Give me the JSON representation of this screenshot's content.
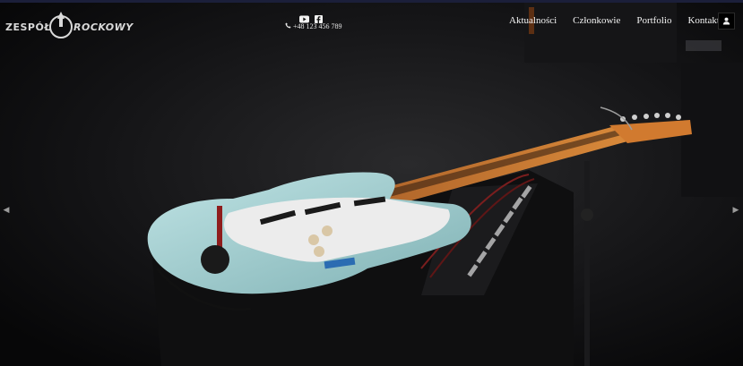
{
  "header": {
    "logo": {
      "word_left": "ZESPÓŁ",
      "word_right": "ROCKOWY"
    },
    "social": [
      {
        "name": "youtube-icon"
      },
      {
        "name": "facebook-icon"
      }
    ],
    "phone": "+48 123 456 789",
    "nav": [
      {
        "label": "Aktualności"
      },
      {
        "label": "Członkowie"
      },
      {
        "label": "Portfolio"
      },
      {
        "label": "Kontakt"
      }
    ],
    "user_icon": "user-icon"
  },
  "hero": {
    "image": "electric-guitar-on-amplifier",
    "prev_icon": "◀",
    "next_icon": "▶"
  },
  "colors": {
    "background": "#0b0b0c",
    "guitar_body": "#a9d2d4",
    "fretboard": "#c9742a",
    "text": "#f2f2f2"
  }
}
